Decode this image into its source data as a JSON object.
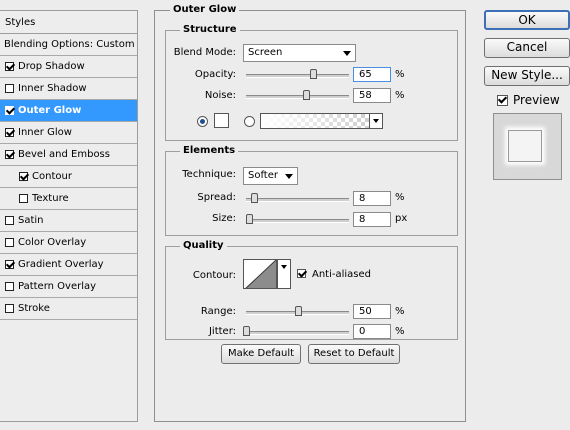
{
  "sidebar": {
    "header": "Styles",
    "blending_options": "Blending Options: Custom",
    "items": [
      {
        "label": "Drop Shadow",
        "checked": true
      },
      {
        "label": "Inner Shadow",
        "checked": false
      },
      {
        "label": "Outer Glow",
        "checked": true,
        "selected": true
      },
      {
        "label": "Inner Glow",
        "checked": true
      },
      {
        "label": "Bevel and Emboss",
        "checked": true
      },
      {
        "label": "Contour",
        "checked": true,
        "indent": true
      },
      {
        "label": "Texture",
        "checked": false,
        "indent": true
      },
      {
        "label": "Satin",
        "checked": false
      },
      {
        "label": "Color Overlay",
        "checked": false
      },
      {
        "label": "Gradient Overlay",
        "checked": true
      },
      {
        "label": "Pattern Overlay",
        "checked": false
      },
      {
        "label": "Stroke",
        "checked": false
      }
    ]
  },
  "panel": {
    "title": "Outer Glow",
    "structure": {
      "title": "Structure",
      "blend_mode_label": "Blend Mode:",
      "blend_mode_value": "Screen",
      "opacity_label": "Opacity:",
      "opacity_value": "65",
      "noise_label": "Noise:",
      "noise_value": "58",
      "percent": "%"
    },
    "elements": {
      "title": "Elements",
      "technique_label": "Technique:",
      "technique_value": "Softer",
      "spread_label": "Spread:",
      "spread_value": "8",
      "size_label": "Size:",
      "size_value": "8",
      "percent": "%",
      "px": "px"
    },
    "quality": {
      "title": "Quality",
      "contour_label": "Contour:",
      "anti_aliased_label": "Anti-aliased",
      "range_label": "Range:",
      "range_value": "50",
      "jitter_label": "Jitter:",
      "jitter_value": "0",
      "percent": "%"
    },
    "make_default": "Make Default",
    "reset_to_default": "Reset to Default"
  },
  "buttons": {
    "ok": "OK",
    "cancel": "Cancel",
    "new_style": "New Style..."
  },
  "preview": {
    "label": "Preview",
    "checked": true
  }
}
